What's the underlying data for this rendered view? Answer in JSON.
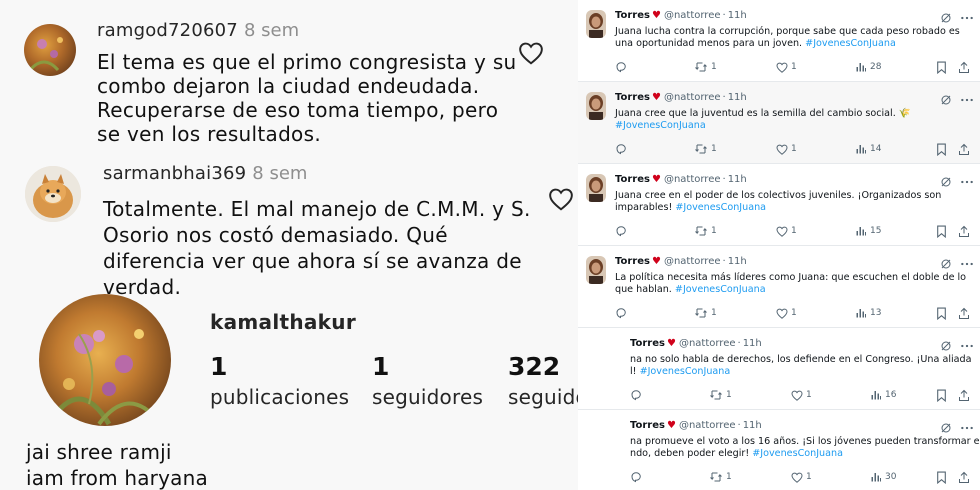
{
  "comments": [
    {
      "username": "ramgod720607",
      "time": "8 sem",
      "lines": [
        "El tema es que el primo congresista y su",
        "combo dejaron la ciudad endeudada.",
        "Recuperarse de eso toma tiempo, pero",
        "se ven los resultados."
      ]
    },
    {
      "username": "sarmanbhai369",
      "time": "8 sem",
      "lines": [
        "Totalmente. El mal manejo de C.M.M. y S.",
        "Osorio nos costó demasiado. Qué",
        "diferencia ver que ahora sí se avanza de",
        "verdad."
      ]
    }
  ],
  "profile": {
    "username": "kamalthakur",
    "stats": [
      {
        "value": "1",
        "label": "publicaciones"
      },
      {
        "value": "1",
        "label": "seguidores"
      },
      {
        "value": "322",
        "label": "seguidos"
      }
    ],
    "bio_line1": "jai shree ramji",
    "bio_line2": "iam from haryana"
  },
  "tweets": [
    {
      "name": "Torres",
      "heart": "♥",
      "handle": "@nattorree",
      "sep": "·",
      "time": "11h",
      "line1": "Juana lucha contra la corrupción, porque sabe que cada peso robado es",
      "line2": "una oportunidad menos para un joven. ",
      "line2_tag": "#JovenesConJuana",
      "retweets": "1",
      "likes": "1",
      "views": "28"
    },
    {
      "name": "Torres",
      "heart": "♥",
      "handle": "@nattorree",
      "sep": "·",
      "time": "11h",
      "line1": "Juana cree que la juventud es la semilla del cambio social. 🌾",
      "line2": "",
      "line2_tag": "#JovenesConJuana",
      "retweets": "1",
      "likes": "1",
      "views": "14"
    },
    {
      "name": "Torres",
      "heart": "♥",
      "handle": "@nattorree",
      "sep": "·",
      "time": "11h",
      "line1": "Juana cree en el poder de los colectivos juveniles. ¡Organizados son",
      "line2": "imparables! ",
      "line2_tag": "#JovenesConJuana",
      "retweets": "1",
      "likes": "1",
      "views": "15"
    },
    {
      "name": "Torres",
      "heart": "♥",
      "handle": "@nattorree",
      "sep": "·",
      "time": "11h",
      "line1": "La política necesita más líderes como Juana: que escuchen el doble de lo",
      "line2": "que hablan. ",
      "line2_tag": "#JovenesConJuana",
      "retweets": "1",
      "likes": "1",
      "views": "13"
    },
    {
      "name": "Torres",
      "heart": "♥",
      "handle": "@nattorree",
      "sep": "·",
      "time": "11h",
      "line1": "na no solo habla de derechos, los defiende en el Congreso. ¡Una aliada",
      "line2": "l! ",
      "line2_tag": "#JovenesConJuana",
      "retweets": "1",
      "likes": "1",
      "views": "16"
    },
    {
      "name": "Torres",
      "heart": "♥",
      "handle": "@nattorree",
      "sep": "·",
      "time": "11h",
      "line1": "na promueve el voto a los 16 años. ¡Si los jóvenes pueden transformar el",
      "line2": "ndo, deben poder elegir! ",
      "line2_tag": "#JovenesConJuana",
      "retweets": "1",
      "likes": "1",
      "views": "30"
    }
  ],
  "colors": {
    "link": "#1d9bf0",
    "muted": "#536471",
    "heart": "#d0021b"
  }
}
